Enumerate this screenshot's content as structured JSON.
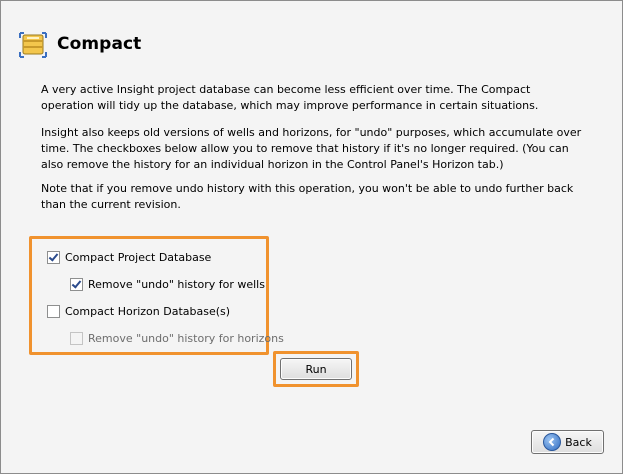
{
  "header": {
    "title": "Compact",
    "icon": "database-compress-icon"
  },
  "paragraphs": [
    "A very active Insight project database can become less efficient over time. The Compact operation will tidy up the database, which may improve performance in certain situations.",
    "Insight also keeps old versions of wells and horizons, for \"undo\" purposes, which accumulate over time. The checkboxes below allow you to remove that history if it's no longer required. (You can also remove the history for an individual horizon in the Control Panel's Horizon tab.)",
    "Note that if you remove undo history with this operation, you won't be able to undo further back than the current revision."
  ],
  "options": {
    "compact_project": {
      "label": "Compact Project Database",
      "checked": true,
      "enabled": true
    },
    "remove_wells": {
      "label": "Remove \"undo\" history for wells",
      "checked": true,
      "enabled": true
    },
    "compact_horizon": {
      "label": "Compact Horizon Database(s)",
      "checked": false,
      "enabled": true
    },
    "remove_horizons": {
      "label": "Remove \"undo\" history for horizons",
      "checked": false,
      "enabled": false
    }
  },
  "buttons": {
    "run": "Run",
    "back": "Back"
  },
  "colors": {
    "highlight": "#f0922e",
    "background": "#f4f4f4"
  }
}
